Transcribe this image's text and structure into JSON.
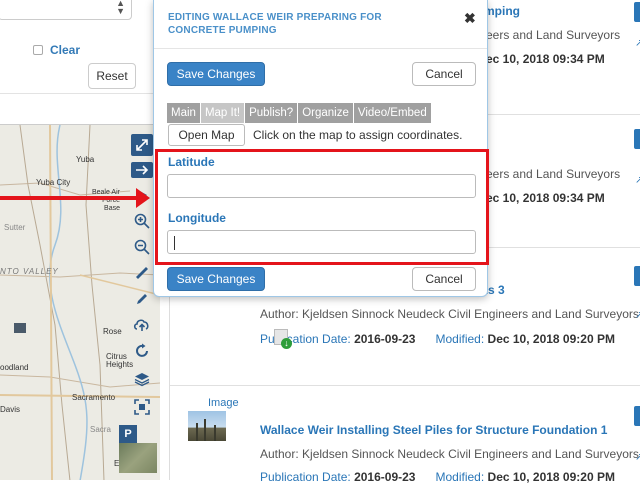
{
  "left_panel": {
    "clear_label": "Clear",
    "reset_label": "Reset"
  },
  "map": {
    "labels": [
      "Yuba",
      "Yuba City",
      "Beale Air Force Base",
      "Sutter",
      "NTO VALLEY",
      "Rose",
      "Citrus Heights",
      "oodland",
      "Sacramento",
      "Davis",
      "Sacra",
      "E"
    ],
    "tools": [
      "expand-icon",
      "arrow-right-icon",
      "zoom-in-icon",
      "zoom-out-icon",
      "ruler-icon",
      "pencil-icon",
      "upload-icon",
      "refresh-icon",
      "layers-icon",
      "fullscreen-icon"
    ],
    "parking_label": "P"
  },
  "dialog": {
    "title": "EDITING WALLACE WEIR PREPARING FOR CONCRETE PUMPING",
    "close": "✖",
    "save_label": "Save Changes",
    "cancel_label": "Cancel",
    "tabs": [
      "Main",
      "Map It!",
      "Publish?",
      "Organize",
      "Video/Embed"
    ],
    "open_map_label": "Open Map",
    "hint": "Click on the map to assign coordinates.",
    "latitude_label": "Latitude",
    "latitude_value": "",
    "longitude_label": "Longitude",
    "longitude_value": ""
  },
  "items": [
    {
      "title_fragment": "mping",
      "author_fragment": "eers and Land Surveyors",
      "modified_fragment": "ec 10, 2018 09:34 PM"
    },
    {
      "author_fragment": "eers and Land Surveyors",
      "modified_fragment": "ec 10, 2018 09:34 PM"
    },
    {
      "title_fragment": "ts 3",
      "author": "Author: Kjeldsen Sinnock Neudeck Civil Engineers and Land Surveyors",
      "pub_label": "Publication Date:",
      "pub_value": "2016-09-23",
      "mod_label": "Modified:",
      "mod_value": "Dec 10, 2018 09:20 PM"
    },
    {
      "type_label": "Image",
      "title": "Wallace Weir Installing Steel Piles for Structure Foundation 1",
      "author": "Author: Kjeldsen Sinnock Neudeck Civil Engineers and Land Surveyors",
      "pub_label": "Publication Date:",
      "pub_value": "2016-09-23",
      "mod_label": "Modified:",
      "mod_value": "Dec 10, 2018 09:20 PM"
    }
  ],
  "colors": {
    "accent": "#2a76b7",
    "primary_button": "#3a83c6",
    "highlight": "#e4141b",
    "tab_inactive": "#a0a0a0"
  }
}
